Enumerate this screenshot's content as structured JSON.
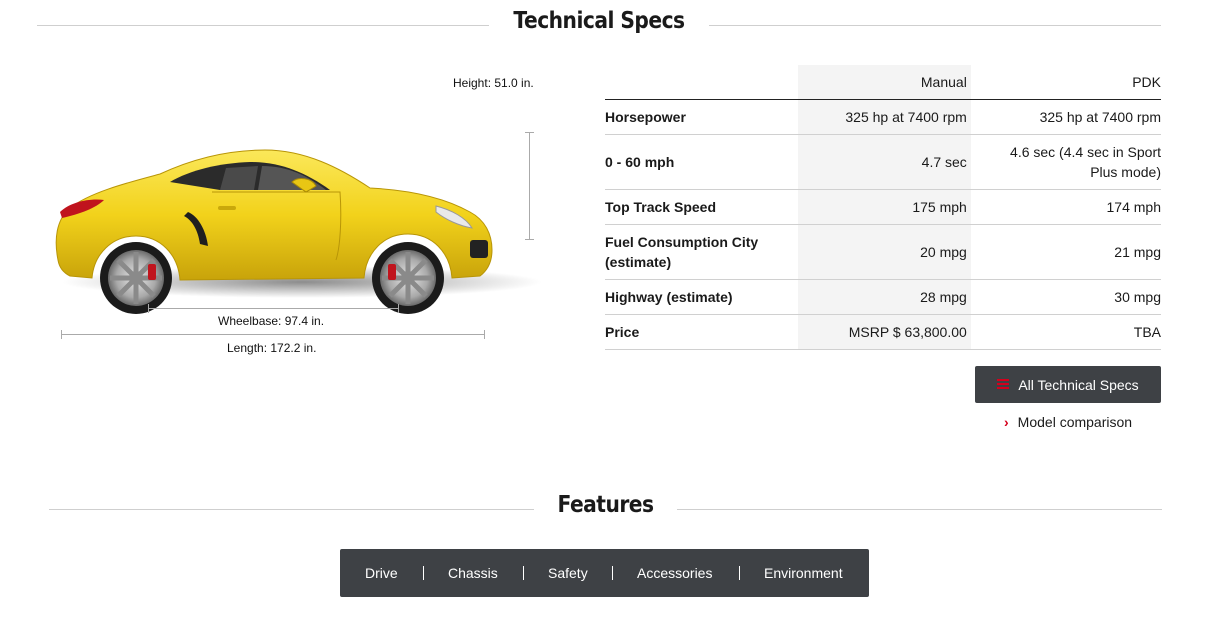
{
  "specs_section": {
    "title": "Technical Specs"
  },
  "dimensions": {
    "height": "Height: 51.0 in.",
    "wheelbase": "Wheelbase: 97.4 in.",
    "length": "Length: 172.2 in."
  },
  "specs_table": {
    "columns": [
      "Manual",
      "PDK"
    ],
    "rows": [
      {
        "label": "Horsepower",
        "manual": "325 hp at 7400 rpm",
        "pdk": "325 hp at 7400 rpm"
      },
      {
        "label": "0 - 60 mph",
        "manual": "4.7 sec",
        "pdk": "4.6 sec (4.4 sec in Sport Plus mode)"
      },
      {
        "label": "Top Track Speed",
        "manual": "175 mph",
        "pdk": "174 mph"
      },
      {
        "label": "Fuel Consumption City (estimate)",
        "manual": "20 mpg",
        "pdk": "21 mpg"
      },
      {
        "label": "Highway (estimate)",
        "manual": "28 mpg",
        "pdk": "30 mpg"
      },
      {
        "label": "Price",
        "manual": "MSRP $ 63,800.00",
        "pdk": "TBA"
      }
    ]
  },
  "actions": {
    "all_specs_label": "All Technical Specs",
    "model_comparison_label": "Model comparison"
  },
  "features_section": {
    "title": "Features",
    "tabs": [
      "Drive",
      "Chassis",
      "Safety",
      "Accessories",
      "Environment"
    ]
  },
  "colors": {
    "car_yellow": "#f2d21b",
    "accent_red": "#d5001c",
    "dark_bar": "#3e4145"
  }
}
